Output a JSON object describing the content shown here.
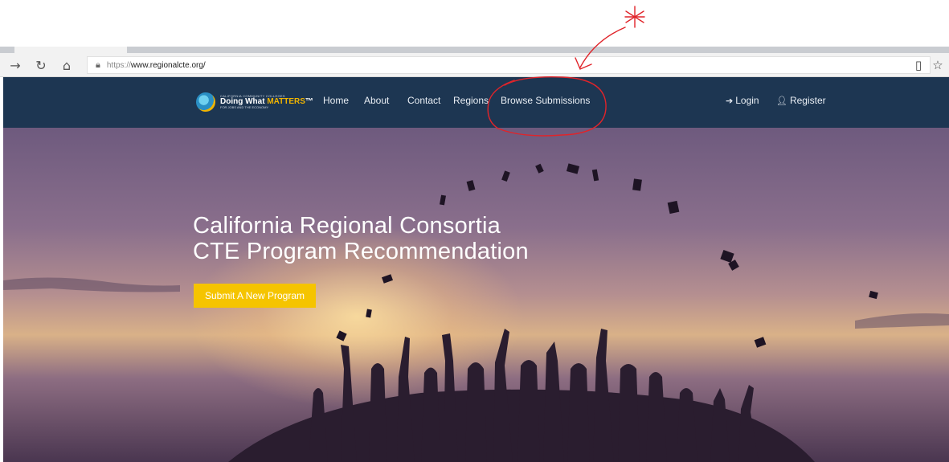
{
  "browser": {
    "url_protocol": "https://",
    "url_host": "www.regionalcte.org/",
    "icons": [
      "forward-icon",
      "refresh-icon",
      "home-icon",
      "lock-icon",
      "reading-view-icon",
      "favorite-star-icon"
    ]
  },
  "nav": {
    "logo": {
      "top_text": "CALIFORNIA COMMUNITY COLLEGES",
      "main_text": "Doing What",
      "main_accent": "MATTERS",
      "tm": "™",
      "sub_text": "FOR JOBS AND THE ECONOMY"
    },
    "items": [
      {
        "label": "Home"
      },
      {
        "label": "About"
      },
      {
        "label": "Contact"
      },
      {
        "label": "Regions"
      },
      {
        "label": "Browse Submissions"
      }
    ],
    "login_label": "Login",
    "register_label": "Register"
  },
  "hero": {
    "title_line1": "California Regional Consortia",
    "title_line2": "CTE Program Recommendation",
    "button_label": "Submit A New Program"
  },
  "colors": {
    "nav_bg": "#1d3652",
    "button_bg": "#f5c400",
    "annotation": "#e0242a"
  }
}
